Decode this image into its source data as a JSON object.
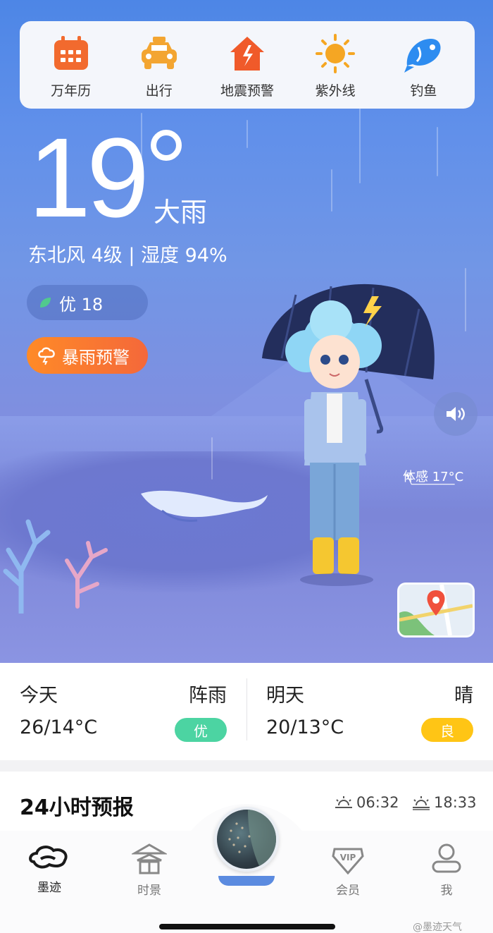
{
  "tools": [
    {
      "label": "万年历",
      "icon": "calendar-icon",
      "color": "#f26a2e"
    },
    {
      "label": "出行",
      "icon": "taxi-icon",
      "color": "#f3a531"
    },
    {
      "label": "地震预警",
      "icon": "earthquake-house-icon",
      "color": "#f05a2a"
    },
    {
      "label": "紫外线",
      "icon": "sun-icon",
      "color": "#f5a623"
    },
    {
      "label": "钓鱼",
      "icon": "fish-icon",
      "color": "#2d8cf0"
    }
  ],
  "weather": {
    "temperature": "19",
    "condition": "大雨",
    "wind_humidity": "东北风 4级 | 湿度 94%",
    "aqi": "优 18",
    "warning": "暴雨预警",
    "feels_like": "体感 17°C"
  },
  "daily": [
    {
      "name": "今天",
      "condition": "阵雨",
      "range": "26/14°C",
      "badge": "优",
      "badge_color": "#4cd4a2"
    },
    {
      "name": "明天",
      "condition": "晴",
      "range": "20/13°C",
      "badge": "良",
      "badge_color": "#ffc515"
    }
  ],
  "hourly": {
    "title": "24小时预报",
    "sunrise": "06:32",
    "sunset": "18:33"
  },
  "nav": [
    {
      "label": "墨迹",
      "icon": "moji-cloud-icon",
      "active": true
    },
    {
      "label": "时景",
      "icon": "pavilion-icon",
      "active": false
    },
    {
      "label": "会员",
      "icon": "vip-icon",
      "active": false
    },
    {
      "label": "我",
      "icon": "profile-icon",
      "active": false
    }
  ],
  "watermark": "@墨迹天气"
}
